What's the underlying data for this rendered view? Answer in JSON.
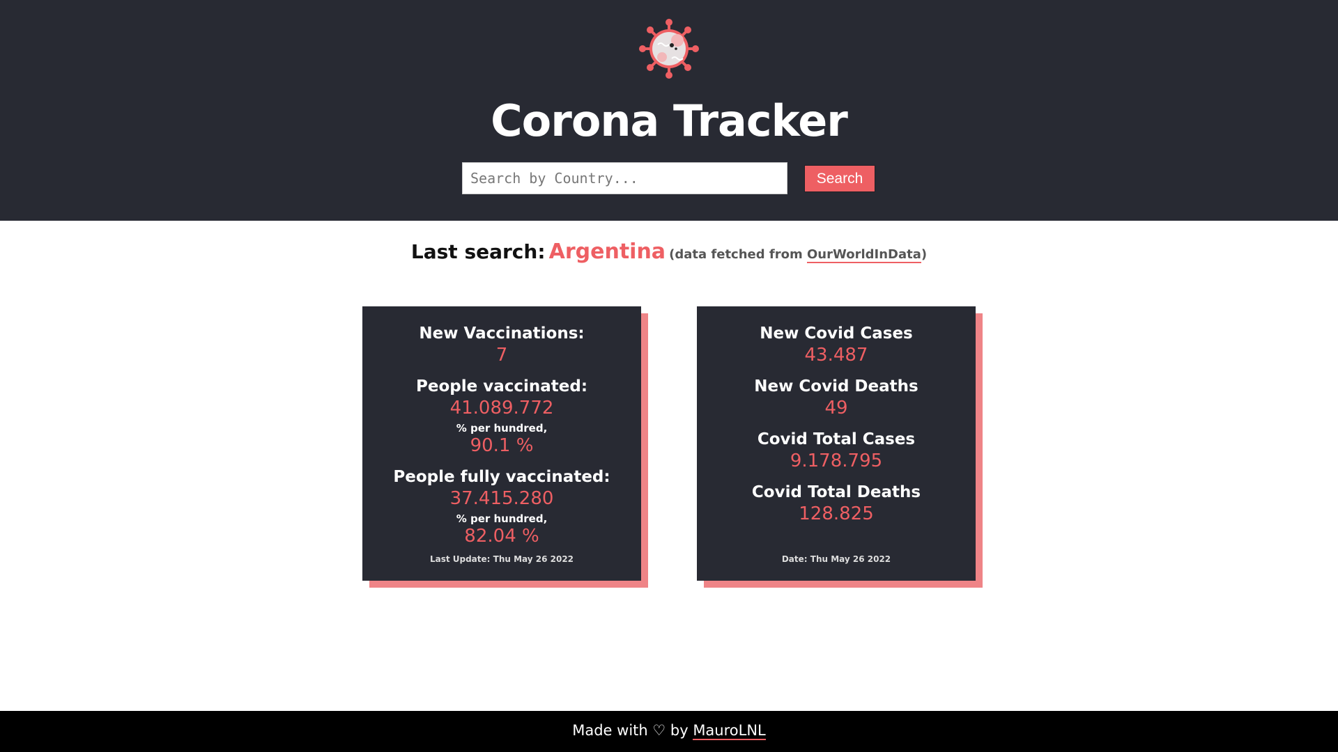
{
  "header": {
    "logo_icon": "virus-icon",
    "title": "Corona Tracker",
    "search_placeholder": "Search by Country...",
    "search_value": "",
    "search_button": "Search"
  },
  "last_search": {
    "label": "Last search:",
    "country": "Argentina",
    "note_prefix": "(data fetched from ",
    "source_link": "OurWorldInData",
    "note_suffix": ")"
  },
  "vaccination_card": {
    "new_vaccinations_label": "New Vaccinations:",
    "new_vaccinations_value": "7",
    "people_vaccinated_label": "People vaccinated:",
    "people_vaccinated_value": "41.089.772",
    "people_vaccinated_sub": "% per hundred,",
    "people_vaccinated_pct": "90.1 %",
    "fully_vaccinated_label": "People fully vaccinated:",
    "fully_vaccinated_value": "37.415.280",
    "fully_vaccinated_sub": "% per hundred,",
    "fully_vaccinated_pct": "82.04 %",
    "last_update": "Last Update: Thu May 26 2022"
  },
  "cases_card": {
    "new_cases_label": "New Covid Cases",
    "new_cases_value": "43.487",
    "new_deaths_label": "New Covid Deaths",
    "new_deaths_value": "49",
    "total_cases_label": "Covid Total Cases",
    "total_cases_value": "9.178.795",
    "total_deaths_label": "Covid Total Deaths",
    "total_deaths_value": "128.825",
    "date": "Date: Thu May 26 2022"
  },
  "footer": {
    "text_prefix": "Made with ♡ by ",
    "author_link": "MauroLNL"
  },
  "colors": {
    "header_bg": "#282a33",
    "accent": "#ee5f63",
    "card_shadow": "#ef8487",
    "footer_bg": "#000000"
  }
}
